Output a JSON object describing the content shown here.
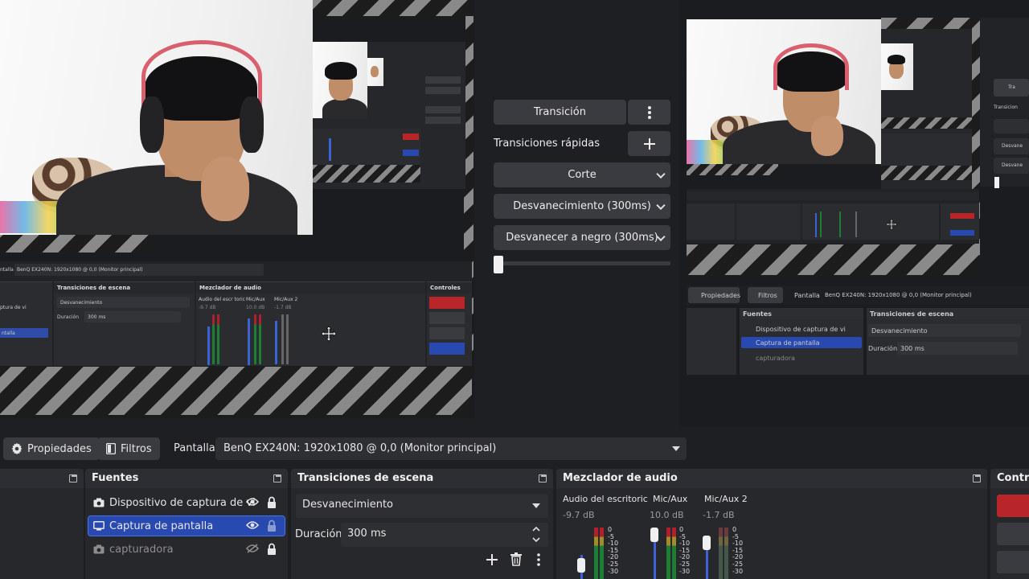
{
  "toolbar": {
    "properties_label": "Propiedades",
    "filters_label": "Filtros",
    "display_label": "Pantalla",
    "display_value": "BenQ EX240N: 1920x1080 @ 0,0 (Monitor principal)"
  },
  "transitions_panel": {
    "transition_button": "Transición",
    "quick_transitions_label": "Transiciones rápidas",
    "quick_items": [
      "Corte",
      "Desvanecimiento (300ms)",
      "Desvanecer a negro (300ms)"
    ]
  },
  "docks": {
    "sources": {
      "title": "Fuentes",
      "items": [
        {
          "label": "Dispositivo de captura de vi",
          "visible": true,
          "locked": true,
          "selected": false
        },
        {
          "label": "Captura de pantalla",
          "visible": true,
          "locked": false,
          "selected": true
        },
        {
          "label": "capturadora",
          "visible": false,
          "locked": true,
          "selected": false
        }
      ]
    },
    "scene_transitions": {
      "title": "Transiciones de escena",
      "transition_value": "Desvanecimiento",
      "duration_label": "Duración",
      "duration_value": "300 ms"
    },
    "audio_mixer": {
      "title": "Mezclador de audio",
      "channels": [
        {
          "name": "Audio del escritoric",
          "db": "-9.7 dB"
        },
        {
          "name": "Mic/Aux",
          "db": "10.0 dB"
        },
        {
          "name": "Mic/Aux 2",
          "db": "-1.7 dB"
        }
      ],
      "scale": [
        "0",
        "-5",
        "-10",
        "-15",
        "-20",
        "-25",
        "-30"
      ]
    },
    "controls": {
      "title": "Contro"
    }
  },
  "mini_ui": {
    "display_text": "BenQ EX240N: 1920x1080 @ 0,0 (Monitor principal)",
    "display_prefix": "ntalla",
    "scene_transitions_title": "Transiciones de escena",
    "audio_mixer_title": "Mezclador de audio",
    "controls_title": "Controles",
    "transition_value": "Desvanecimiento",
    "duration_label": "Duración",
    "duration_value": "300 ms",
    "src1": "ptura de vi",
    "src2": "ntalla",
    "ch1": "Audio del escr toric",
    "ch2": "Mic/Aux",
    "ch3": "Mic/Aux 2",
    "db1": "-9.7 dB",
    "db2": "10.0 dB",
    "db3": "-1.7 dB"
  },
  "program_mini": {
    "properties": "Propiedades",
    "filters": "Filtros",
    "display": "Pantalla",
    "display_value": "BenQ EX240N: 1920x1080 @ 0,0 (Monitor principal)",
    "sources_title": "Fuentes",
    "scene_transitions_title": "Transiciones de escena",
    "sources": [
      "Dispositivo de captura de vi",
      "Captura de pantalla",
      "capturadora"
    ],
    "transition_value": "Desvanecimiento",
    "duration_label": "Duración",
    "duration_value": "300 ms",
    "side_labels": [
      "Tra",
      "Transicion",
      "Desvane",
      "Desvane"
    ]
  },
  "colors": {
    "selection": "#2849b0",
    "panel": "#27282c",
    "button": "#3a3b40",
    "stripe_light": "#8a8a8a",
    "controls_red": "#b8262a"
  }
}
